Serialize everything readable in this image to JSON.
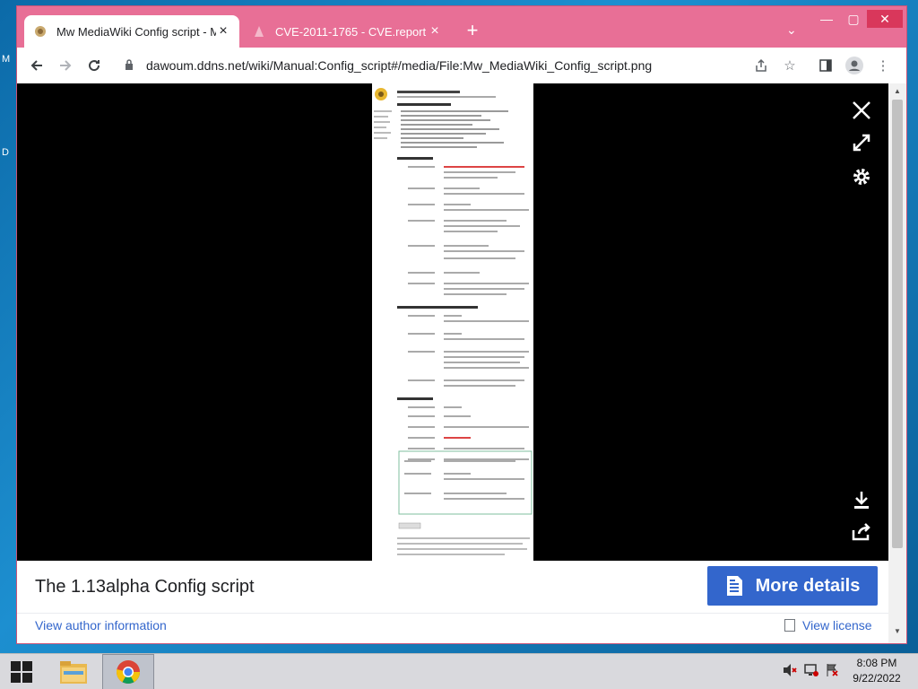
{
  "desktop": {
    "glyph_m": "M",
    "glyph_d": "D"
  },
  "tabs": [
    {
      "title": "Mw MediaWiki Config script - M",
      "active": true
    },
    {
      "title": "CVE-2011-1765 - CVE.report",
      "active": false
    }
  ],
  "window_controls": {
    "minimize": "—",
    "maximize": "▢",
    "close": "✕"
  },
  "address_bar": {
    "url": "dawoum.ddns.net/wiki/Manual:Config_script#/media/File:Mw_MediaWiki_Config_script.png"
  },
  "media_viewer": {
    "caption": "The 1.13alpha Config script",
    "more_details_label": "More details",
    "author_link": "View author information",
    "license_link": "View license"
  },
  "taskbar": {
    "time": "8:08 PM",
    "date": "9/22/2022"
  },
  "colors": {
    "window_frame": "#e86f96",
    "link_blue": "#3366cc",
    "primary_button": "#3366cc"
  }
}
